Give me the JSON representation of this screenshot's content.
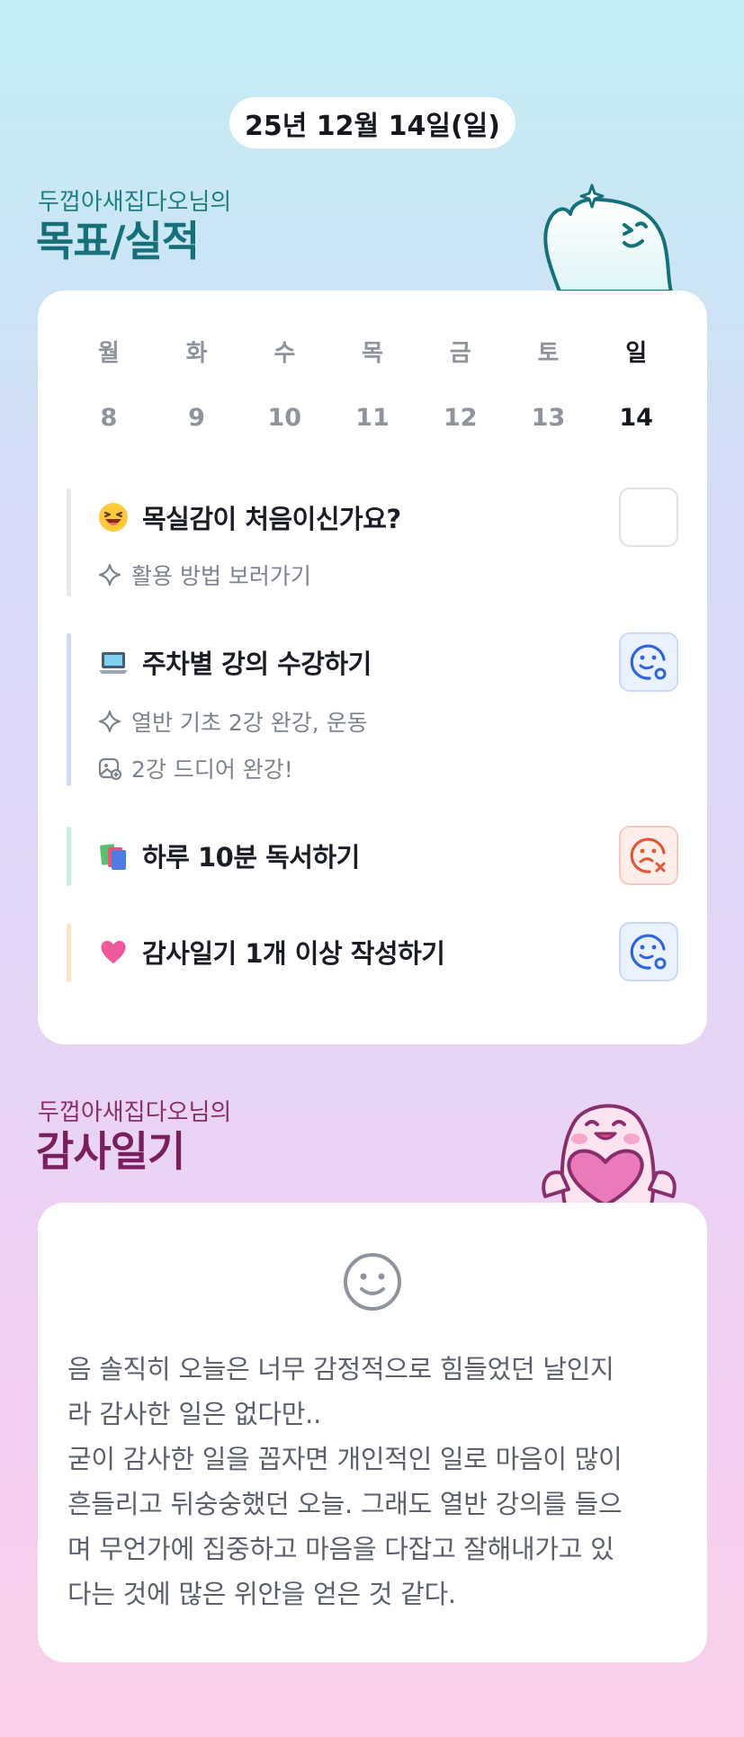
{
  "header": {
    "date": "25년 12월 14일(일)"
  },
  "goals_section": {
    "subtitle": "두껍아새집다오님의",
    "title": "목표/실적",
    "week": [
      {
        "day": "월",
        "date": "8"
      },
      {
        "day": "화",
        "date": "9"
      },
      {
        "day": "수",
        "date": "10"
      },
      {
        "day": "목",
        "date": "11"
      },
      {
        "day": "금",
        "date": "12"
      },
      {
        "day": "토",
        "date": "13"
      },
      {
        "day": "일",
        "date": "14",
        "active": true
      }
    ],
    "goals": [
      {
        "emoji_icon": "laughing-face-icon",
        "title": "목실감이 처음이신가요?",
        "notes": [
          {
            "icon": "sparkle-icon",
            "text": "활용 방법 보러가기"
          }
        ],
        "status": "empty",
        "bar_color": "#e6e8eb"
      },
      {
        "emoji_icon": "laptop-icon",
        "title": "주차별 강의 수강하기",
        "notes": [
          {
            "icon": "sparkle-icon",
            "text": "열반 기초 2강 완강, 운동"
          },
          {
            "icon": "photo-icon",
            "text": "2강 드디어 완강!"
          }
        ],
        "status": "done",
        "bar_color": "#cdd9f6"
      },
      {
        "emoji_icon": "books-icon",
        "title": "하루 10분 독서하기",
        "notes": [],
        "status": "failed",
        "bar_color": "#c5f0df"
      },
      {
        "emoji_icon": "heart-icon",
        "title": "감사일기 1개 이상 작성하기",
        "notes": [],
        "status": "done",
        "bar_color": "#fde4c4"
      }
    ]
  },
  "diary_section": {
    "subtitle": "두껍아새집다오님의",
    "title": "감사일기",
    "mood_icon": "smile-face-icon",
    "text": "음 솔직히 오늘은 너무 감정적으로 힘들었던 날인지\n라 감사한 일은 없다만..\n굳이 감사한 일을 꼽자면 개인적인 일로 마음이 많이\n흔들리고 뒤숭숭했던 오늘. 그래도 열반 강의를 들으\n며 무언가에 집중하고 마음을 다잡고 잘해내가고 있\n다는 것에 많은 위안을 얻은 것 같다."
  },
  "colors": {
    "goals_accent": "#16707a",
    "diary_accent": "#7a1f5d",
    "status_done": "#2f63e0",
    "status_failed": "#e0573a"
  }
}
